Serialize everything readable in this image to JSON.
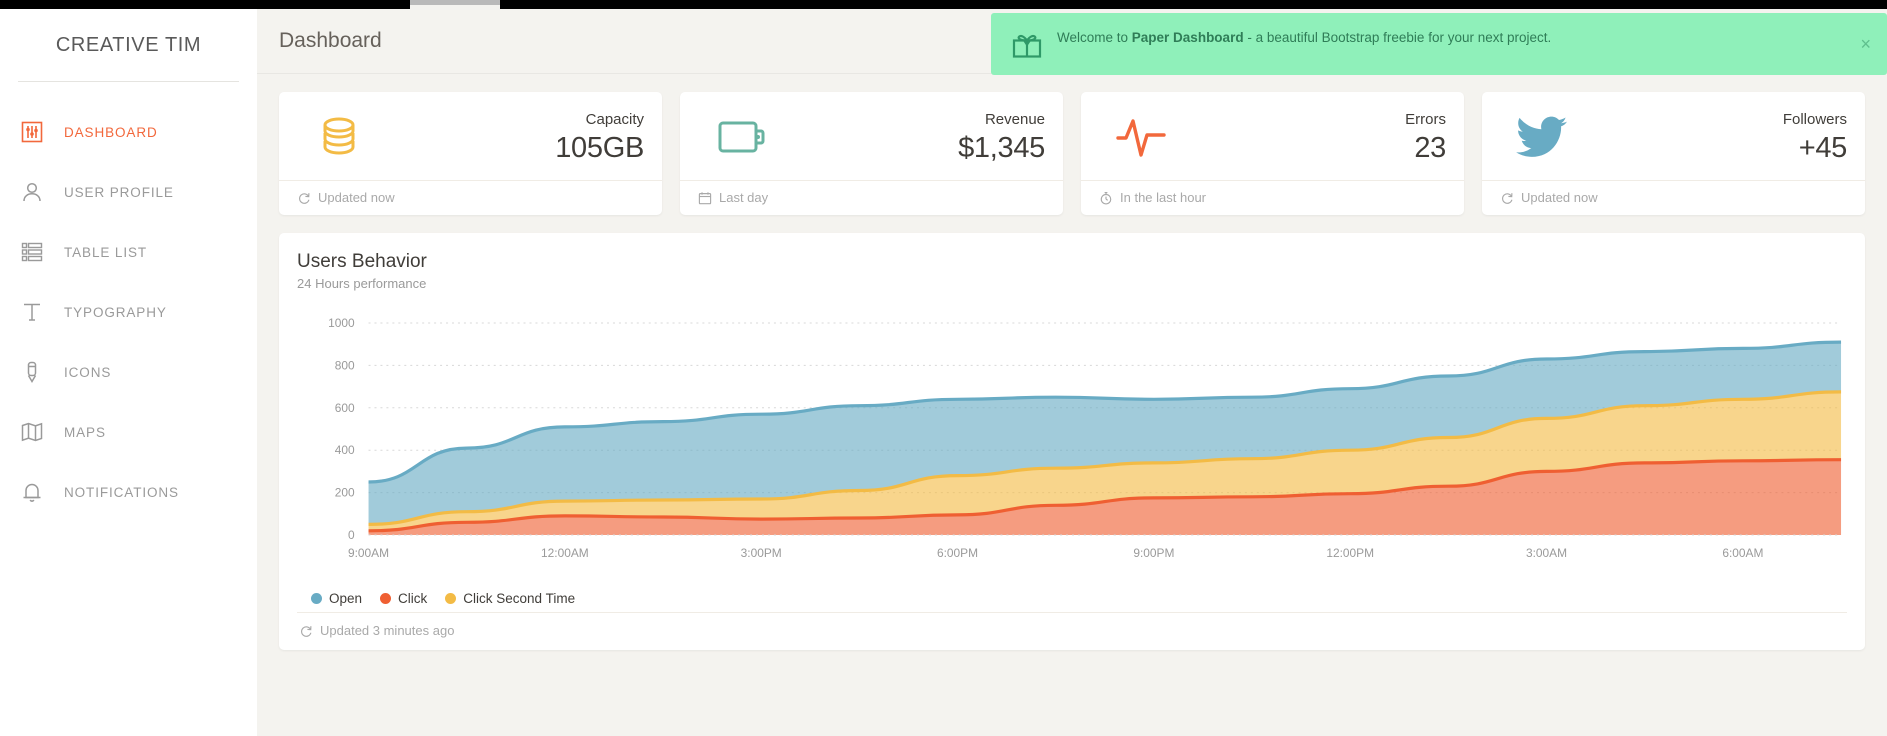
{
  "sidebar": {
    "brand": "CREATIVE TIM",
    "items": [
      {
        "label": "DASHBOARD",
        "icon": "sliders-icon",
        "active": true
      },
      {
        "label": "USER PROFILE",
        "icon": "user-icon",
        "active": false
      },
      {
        "label": "TABLE LIST",
        "icon": "list-icon",
        "active": false
      },
      {
        "label": "TYPOGRAPHY",
        "icon": "text-icon",
        "active": false
      },
      {
        "label": "ICONS",
        "icon": "pencil-icon",
        "active": false
      },
      {
        "label": "MAPS",
        "icon": "map-icon",
        "active": false
      },
      {
        "label": "NOTIFICATIONS",
        "icon": "bell-icon",
        "active": false
      }
    ]
  },
  "navbar": {
    "title": "Dashboard"
  },
  "alert": {
    "icon": "gift-icon",
    "prefix": "Welcome to ",
    "bold": "Paper Dashboard",
    "suffix": " - a beautiful Bootstrap freebie for your next project.",
    "close_label": "×",
    "background": "#8ff0ba",
    "text_color": "#2f7d57"
  },
  "stats": [
    {
      "icon": "database-icon",
      "icon_color": "#f3bb45",
      "label": "Capacity",
      "value": "105GB",
      "foot_icon": "refresh-icon",
      "foot": "Updated now"
    },
    {
      "icon": "wallet-icon",
      "icon_color": "#68b3a1",
      "label": "Revenue",
      "value": "$1,345",
      "foot_icon": "calendar-icon",
      "foot": "Last day"
    },
    {
      "icon": "pulse-icon",
      "icon_color": "#f2683c",
      "label": "Errors",
      "value": "23",
      "foot_icon": "clock-icon",
      "foot": "In the last hour"
    },
    {
      "icon": "twitter-icon",
      "icon_color": "#68abc4",
      "label": "Followers",
      "value": "+45",
      "foot_icon": "refresh-icon",
      "foot": "Updated now"
    }
  ],
  "chart_card": {
    "title": "Users Behavior",
    "subtitle": "24 Hours performance",
    "foot_icon": "refresh-icon",
    "foot": "Updated 3 minutes ago"
  },
  "chart_data": {
    "type": "area",
    "title": "Users Behavior",
    "subtitle": "24 Hours performance",
    "xlabel": "",
    "ylabel": "",
    "stacked": true,
    "grid": true,
    "legend_position": "bottom-left",
    "ylim": [
      0,
      1000
    ],
    "yticks": [
      0,
      200,
      400,
      600,
      800,
      1000
    ],
    "categories": [
      "9:00AM",
      "12:00AM",
      "3:00PM",
      "6:00PM",
      "9:00PM",
      "12:00PM",
      "3:00AM",
      "6:00AM"
    ],
    "x": [
      "9:00AM",
      "10:30AM",
      "12:00AM",
      "1:30PM",
      "3:00PM",
      "4:30PM",
      "6:00PM",
      "7:30PM",
      "9:00PM",
      "10:30PM",
      "12:00PM",
      "1:30AM",
      "3:00AM",
      "4:30AM",
      "6:00AM",
      "7:30AM"
    ],
    "series": [
      {
        "name": "Click",
        "color": "#ef5f32",
        "values": [
          20,
          60,
          90,
          85,
          75,
          80,
          95,
          140,
          175,
          180,
          195,
          230,
          300,
          340,
          350,
          355
        ]
      },
      {
        "name": "Click Second Time",
        "color": "#f3bb45",
        "values": [
          30,
          50,
          70,
          80,
          95,
          130,
          185,
          175,
          165,
          180,
          205,
          230,
          250,
          270,
          290,
          320
        ]
      },
      {
        "name": "Open",
        "color": "#68abc4",
        "values": [
          200,
          300,
          350,
          370,
          400,
          400,
          360,
          335,
          300,
          290,
          290,
          290,
          280,
          255,
          240,
          235
        ]
      }
    ],
    "legend": [
      {
        "label": "Open",
        "color": "#68abc4"
      },
      {
        "label": "Click",
        "color": "#ef5f32"
      },
      {
        "label": "Click Second Time",
        "color": "#f3bb45"
      }
    ]
  }
}
